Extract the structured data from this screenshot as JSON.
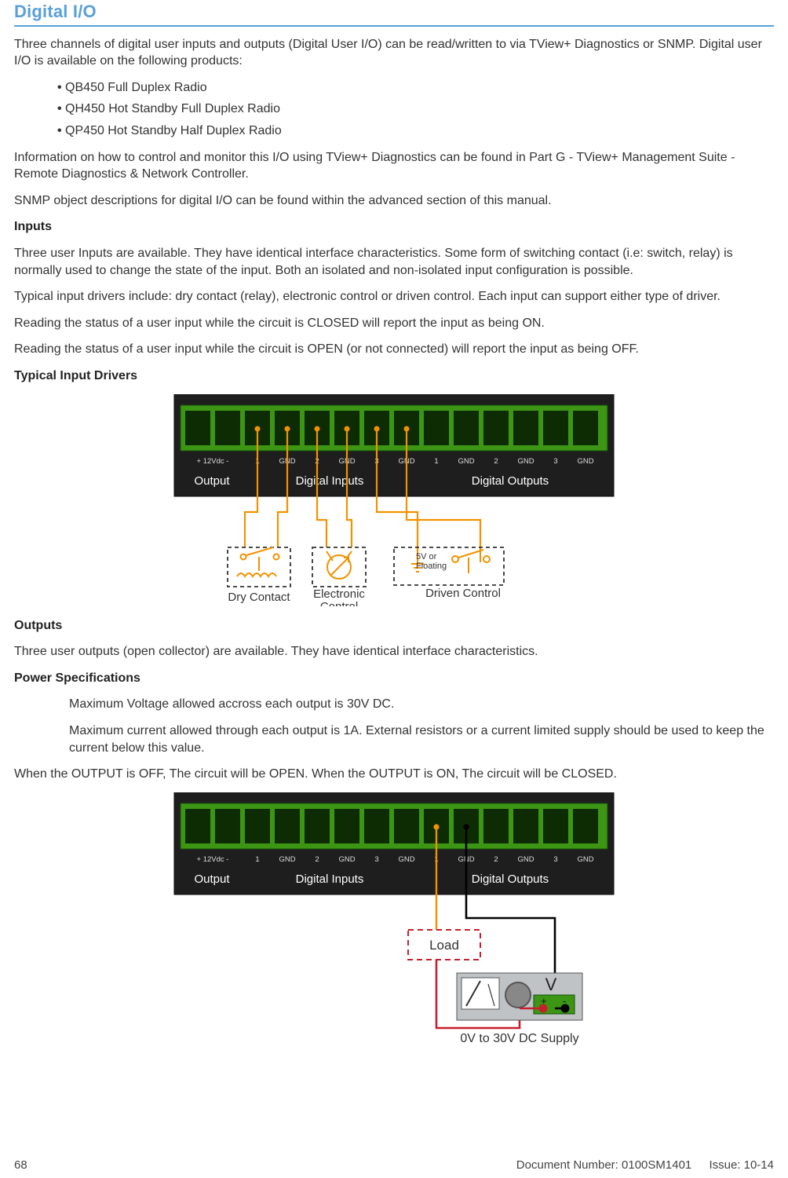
{
  "section_title": "Digital I/O",
  "intro": "Three channels of digital user inputs and outputs (Digital User I/O) can be read/written to via TView+ Diagnostics or SNMP. Digital user I/O is available on the following products:",
  "products": [
    "QB450 Full Duplex Radio",
    "QH450 Hot Standby Full Duplex Radio",
    "QP450 Hot Standby Half Duplex Radio"
  ],
  "p_info": "Information on how to control and monitor this I/O using TView+ Diagnostics can be found in Part G - TView+ Management Suite - Remote Diagnostics & Network Controller.",
  "p_snmp": "SNMP object descriptions for digital I/O can be found within the advanced section of this manual.",
  "h_inputs": "Inputs",
  "p_inputs1": "Three user Inputs are available. They have identical interface characteristics. Some form of switching contact (i.e: switch, relay) is normally used to change the state of the input. Both an isolated and non-isolated input configuration is possible.",
  "p_inputs2": "Typical input drivers include: dry contact (relay), electronic control or driven control. Each input can support either type of driver.",
  "p_inputs3": "Reading the status of a user input while the circuit is CLOSED will report the input as being ON.",
  "p_inputs4": "Reading the status of a user input while the circuit is OPEN (or not connected) will report the input as being OFF.",
  "h_typical": "Typical Input Drivers",
  "terminal_pin_labels": [
    "+ 12Vdc -",
    "1",
    "GND",
    "2",
    "GND",
    "3",
    "GND",
    "1",
    "GND",
    "2",
    "GND",
    "3",
    "GND"
  ],
  "terminal_group_labels": {
    "output": "Output",
    "din": "Digital Inputs",
    "dout": "Digital Outputs"
  },
  "fig1": {
    "dry": "Dry Contact",
    "elec": "Electronic\nControl",
    "driven": "Driven Control",
    "float": "5V or\nFloating"
  },
  "h_outputs": "Outputs",
  "p_outputs1": "Three user outputs (open collector) are available. They have identical interface characteristics.",
  "h_power": "Power Specifications",
  "p_power1": "Maximum Voltage allowed accross each output is 30V DC.",
  "p_power2": "Maximum current allowed through each output is 1A. External resistors or a current limited supply should be used to keep the current below this value.",
  "p_outstate": "When the OUTPUT is OFF, The circuit will be OPEN. When the OUTPUT is ON, The circuit will be CLOSED.",
  "fig2": {
    "load": "Load",
    "v": "V",
    "plus": "+",
    "minus": "-",
    "supply": "0V to 30V DC Supply"
  },
  "footer": {
    "page": "68",
    "doc": "Document Number: 0100SM1401",
    "issue": "Issue: 10-14"
  }
}
